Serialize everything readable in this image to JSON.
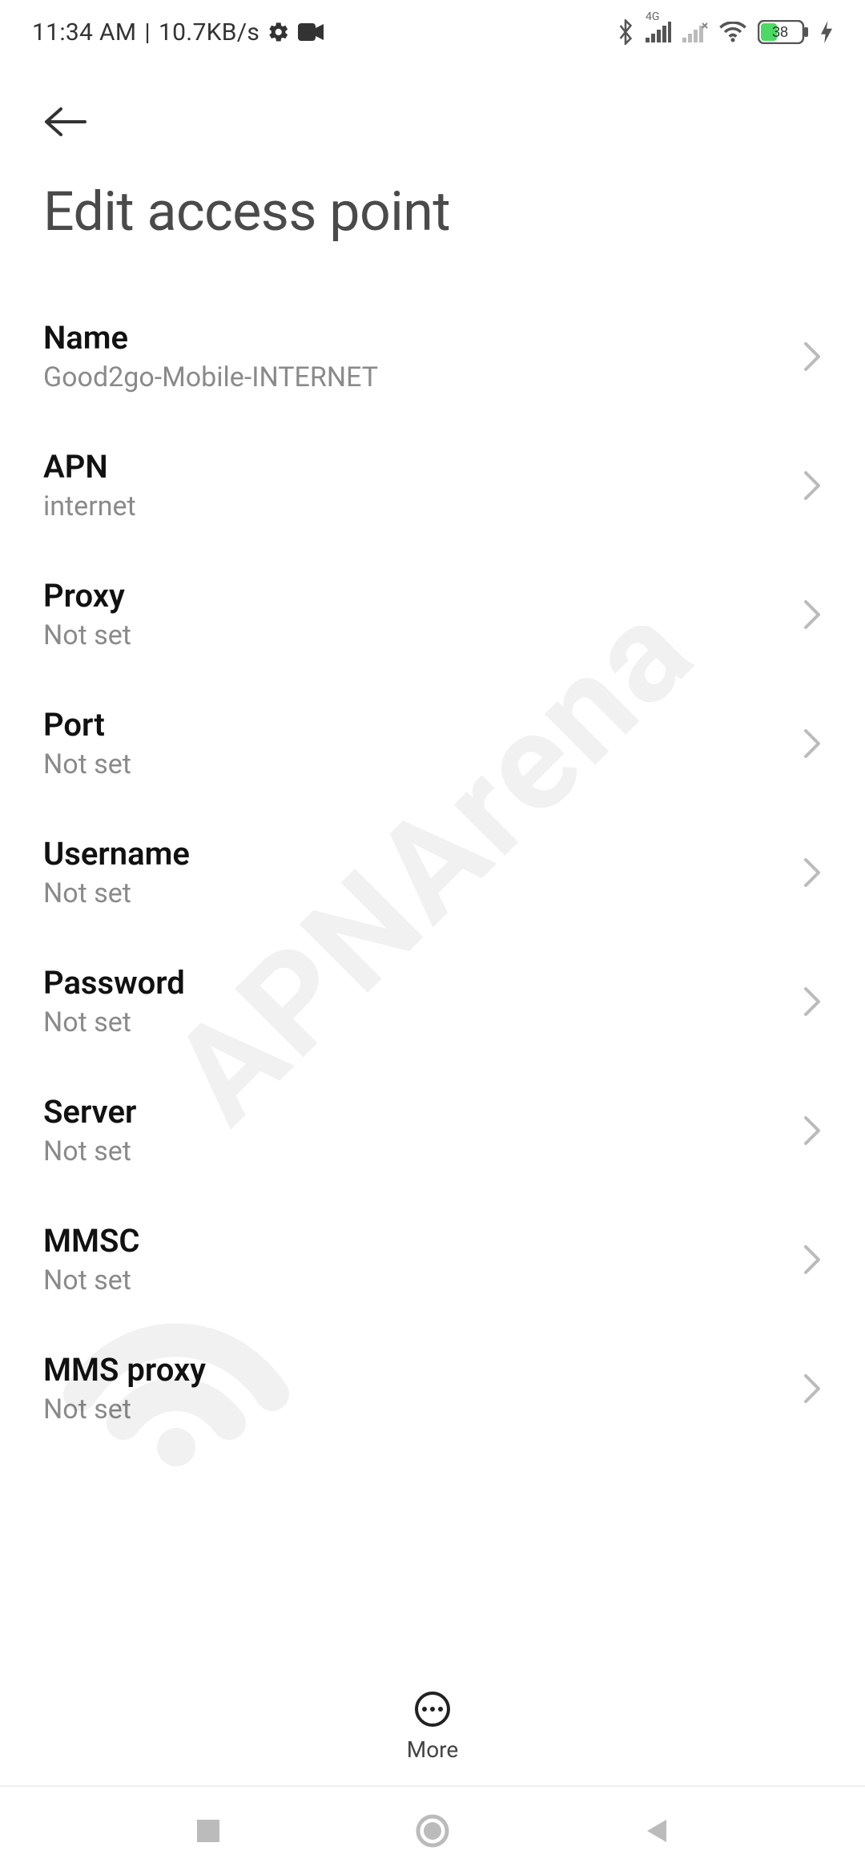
{
  "statusbar": {
    "time": "11:34 AM",
    "sep": " | ",
    "speed": "10.7KB/s",
    "network_label": "4G",
    "battery_percent": "38"
  },
  "header": {
    "title": "Edit access point"
  },
  "settings": [
    {
      "label": "Name",
      "value": "Good2go-Mobile-INTERNET"
    },
    {
      "label": "APN",
      "value": "internet"
    },
    {
      "label": "Proxy",
      "value": "Not set"
    },
    {
      "label": "Port",
      "value": "Not set"
    },
    {
      "label": "Username",
      "value": "Not set"
    },
    {
      "label": "Password",
      "value": "Not set"
    },
    {
      "label": "Server",
      "value": "Not set"
    },
    {
      "label": "MMSC",
      "value": "Not set"
    },
    {
      "label": "MMS proxy",
      "value": "Not set"
    }
  ],
  "actions": {
    "more_label": "More"
  },
  "watermark": {
    "text": "APNArena"
  }
}
